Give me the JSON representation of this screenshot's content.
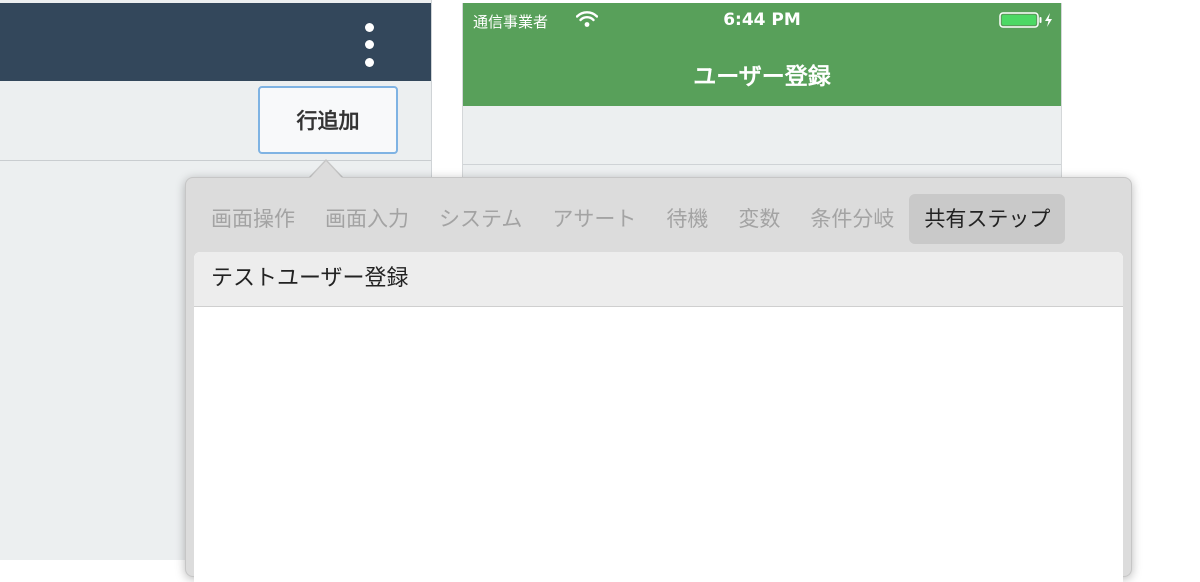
{
  "left_pane": {
    "header": {
      "menu_icon": "more-vertical-icon"
    },
    "toolbar": {
      "add_row_label": "行追加"
    }
  },
  "phone": {
    "status_bar": {
      "carrier": "通信事業者",
      "wifi_icon": "wifi-icon",
      "time": "6:44 PM",
      "battery_icon": "battery-charging-icon"
    },
    "nav_title": "ユーザー登録"
  },
  "popover": {
    "tabs": [
      {
        "label": "画面操作",
        "active": false
      },
      {
        "label": "画面入力",
        "active": false
      },
      {
        "label": "システム",
        "active": false
      },
      {
        "label": "アサート",
        "active": false
      },
      {
        "label": "待機",
        "active": false
      },
      {
        "label": "変数",
        "active": false
      },
      {
        "label": "条件分岐",
        "active": false
      },
      {
        "label": "共有ステップ",
        "active": true
      }
    ],
    "items": [
      {
        "label": "テストユーザー登録"
      }
    ]
  },
  "colors": {
    "left_header_bg": "#33475b",
    "phone_bar_green": "#58a05a",
    "battery_green": "#4cd964",
    "button_border": "#7fb3e3"
  }
}
